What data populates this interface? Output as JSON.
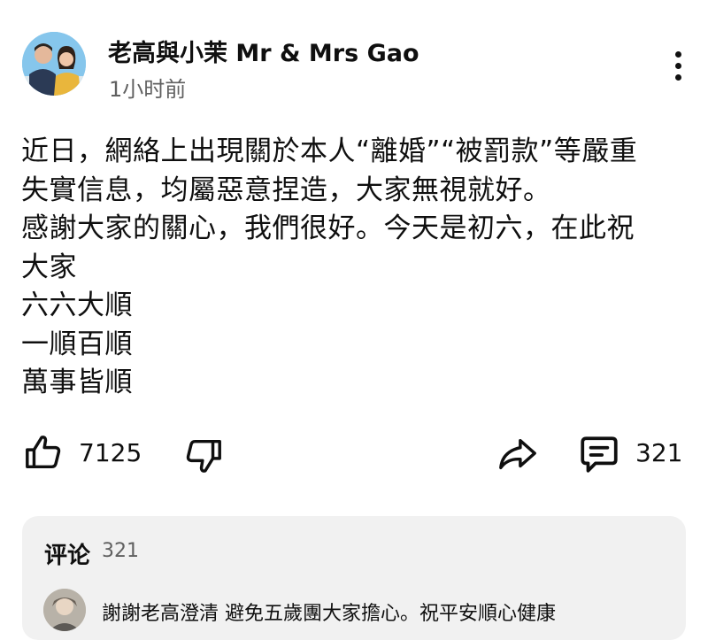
{
  "post": {
    "channel_name": "老高與小茉 Mr & Mrs Gao",
    "time": "1小时前",
    "lines": [
      "近日，網絡上出現關於本人“離婚”“被罰款”等嚴重",
      "失實信息，均屬惡意捏造，大家無視就好。",
      "感謝大家的關心，我們很好。今天是初六，在此祝",
      "大家",
      "六六大順",
      "一順百順",
      "萬事皆順"
    ]
  },
  "actions": {
    "like_count": "7125",
    "comment_count": "321",
    "icons": [
      "thumbs-up-icon",
      "thumbs-down-icon",
      "share-icon",
      "comment-icon"
    ]
  },
  "comments": {
    "title": "评论",
    "count": "321",
    "first_comment": "謝謝老高澄清 避免五歲團大家擔心。祝平安順心健康"
  }
}
